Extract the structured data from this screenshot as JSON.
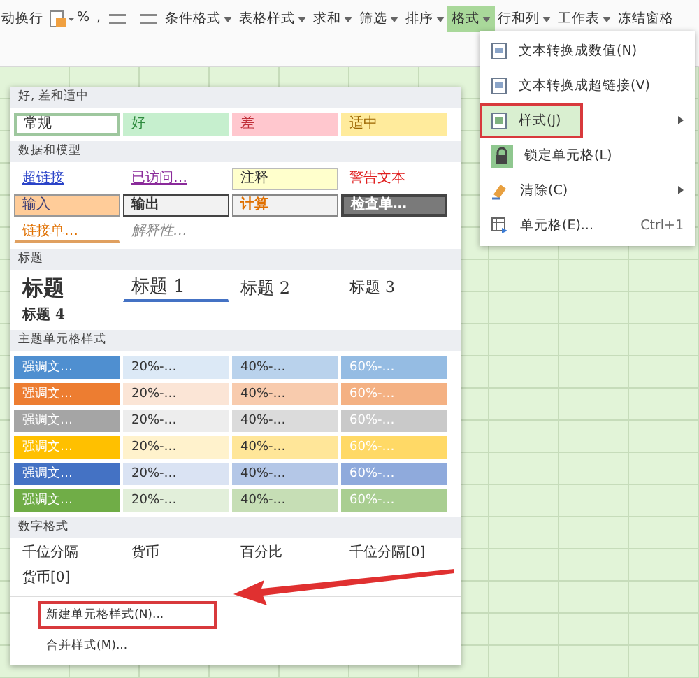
{
  "toolbar": {
    "items": [
      {
        "label": "动换行",
        "kind": "text",
        "selected": false
      },
      {
        "kind": "fill-icon",
        "selected": false
      },
      {
        "label": "%",
        "kind": "text",
        "selected": false
      },
      {
        "label": ",",
        "kind": "text",
        "selected": false
      },
      {
        "kind": "decimal-icon",
        "selected": false
      },
      {
        "label": "条件格式",
        "kind": "dropdown",
        "selected": false
      },
      {
        "label": "表格样式",
        "kind": "dropdown",
        "selected": false
      },
      {
        "label": "求和",
        "kind": "dropdown",
        "selected": false
      },
      {
        "label": "筛选",
        "kind": "dropdown",
        "selected": false
      },
      {
        "label": "排序",
        "kind": "dropdown",
        "selected": false
      },
      {
        "label": "格式",
        "kind": "dropdown",
        "selected": true
      },
      {
        "label": "行和列",
        "kind": "dropdown",
        "selected": false
      },
      {
        "label": "工作表",
        "kind": "dropdown",
        "selected": false
      },
      {
        "label": "冻结窗格",
        "kind": "text",
        "selected": false
      }
    ]
  },
  "format_menu": {
    "items": [
      {
        "label": "文本转换成数值(N)",
        "kind": "doc",
        "submenu": false,
        "selected": false,
        "highlighted": false
      },
      {
        "label": "文本转换成超链接(V)",
        "kind": "doc",
        "submenu": false,
        "selected": false,
        "highlighted": false
      },
      {
        "label": "样式(J)",
        "kind": "style",
        "submenu": true,
        "selected": true,
        "highlighted": true
      },
      {
        "label": "锁定单元格(L)",
        "kind": "lock",
        "submenu": false,
        "selected": false,
        "highlighted": false
      },
      {
        "label": "清除(C)",
        "kind": "eraser",
        "submenu": true,
        "selected": false,
        "highlighted": false
      },
      {
        "label": "单元格(E)...",
        "kind": "cell",
        "shortcut": "Ctrl+1",
        "submenu": false,
        "selected": false,
        "highlighted": false
      }
    ]
  },
  "styles_panel": {
    "good_bad": {
      "title": "好, 差和适中",
      "cells": [
        {
          "label": "常规",
          "kind": "normal"
        },
        {
          "label": "好",
          "kind": "good"
        },
        {
          "label": "差",
          "kind": "bad"
        },
        {
          "label": "适中",
          "kind": "neutral"
        }
      ]
    },
    "data_model": {
      "title": "数据和模型",
      "cells": [
        {
          "label": "超链接",
          "kind": "link"
        },
        {
          "label": "已访问…",
          "kind": "visited"
        },
        {
          "label": "注释",
          "kind": "note"
        },
        {
          "label": "警告文本",
          "kind": "warning"
        },
        {
          "label": "输入",
          "kind": "input"
        },
        {
          "label": "输出",
          "kind": "output"
        },
        {
          "label": "计算",
          "kind": "calc"
        },
        {
          "label": "检查单…",
          "kind": "check"
        },
        {
          "label": "链接单…",
          "kind": "linked"
        },
        {
          "label": "解释性…",
          "kind": "explain"
        }
      ]
    },
    "headings": {
      "title": "标题",
      "cells": [
        {
          "label": "标题",
          "kind": "title"
        },
        {
          "label": "标题 1",
          "kind": "h1"
        },
        {
          "label": "标题 2",
          "kind": "h2"
        },
        {
          "label": "标题 3",
          "kind": "h3"
        },
        {
          "label": "标题 4",
          "kind": "h4"
        }
      ]
    },
    "theme": {
      "title": "主题单元格样式",
      "rows": [
        {
          "color": "#4f8fd0",
          "cells": [
            "强调文…",
            "20%-…",
            "40%-…",
            "60%-…"
          ]
        },
        {
          "color": "#ed7d31",
          "cells": [
            "强调文…",
            "20%-…",
            "40%-…",
            "60%-…"
          ]
        },
        {
          "color": "#a5a5a5",
          "cells": [
            "强调文…",
            "20%-…",
            "40%-…",
            "60%-…"
          ]
        },
        {
          "color": "#ffc000",
          "cells": [
            "强调文…",
            "20%-…",
            "40%-…",
            "60%-…"
          ]
        },
        {
          "color": "#4472c4",
          "cells": [
            "强调文…",
            "20%-…",
            "40%-…",
            "60%-…"
          ]
        },
        {
          "color": "#70ad47",
          "cells": [
            "强调文…",
            "20%-…",
            "40%-…",
            "60%-…"
          ]
        }
      ]
    },
    "number": {
      "title": "数字格式",
      "items": [
        "千位分隔",
        "货币",
        "百分比",
        "千位分隔[0]",
        "货币[0]"
      ]
    },
    "actions": [
      {
        "label": "新建单元格样式(N)...",
        "highlighted": true
      },
      {
        "label": "合并样式(M)...",
        "highlighted": false
      }
    ]
  }
}
